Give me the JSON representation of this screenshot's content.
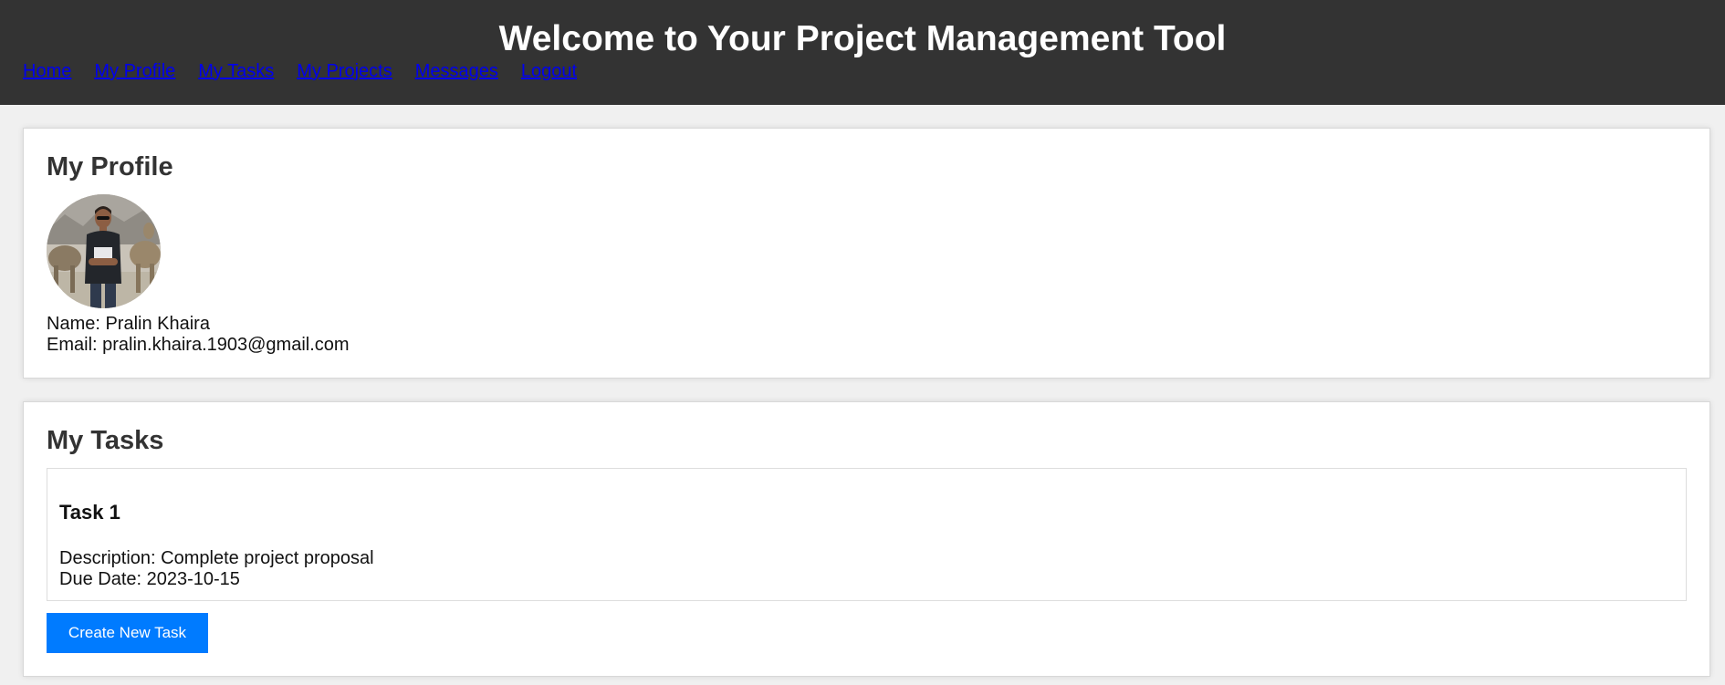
{
  "header": {
    "title": "Welcome to Your Project Management Tool"
  },
  "nav": {
    "items": [
      {
        "label": "Home"
      },
      {
        "label": "My Profile"
      },
      {
        "label": "My Tasks"
      },
      {
        "label": "My Projects"
      },
      {
        "label": "Messages"
      },
      {
        "label": "Logout"
      }
    ]
  },
  "profile": {
    "heading": "My Profile",
    "avatar": "profile-photo",
    "name_text": "Name: Pralin Khaira",
    "email_text": "Email: pralin.khaira.1903@gmail.com"
  },
  "tasks": {
    "heading": "My Tasks",
    "items": [
      {
        "title": "Task 1",
        "description_text": "Description: Complete project proposal",
        "due_text": "Due Date: 2023-10-15"
      }
    ],
    "create_label": "Create New Task"
  },
  "colors": {
    "header_bg": "#333333",
    "link": "#0000ee",
    "button": "#007bff",
    "page_bg": "#f0f0f0"
  }
}
